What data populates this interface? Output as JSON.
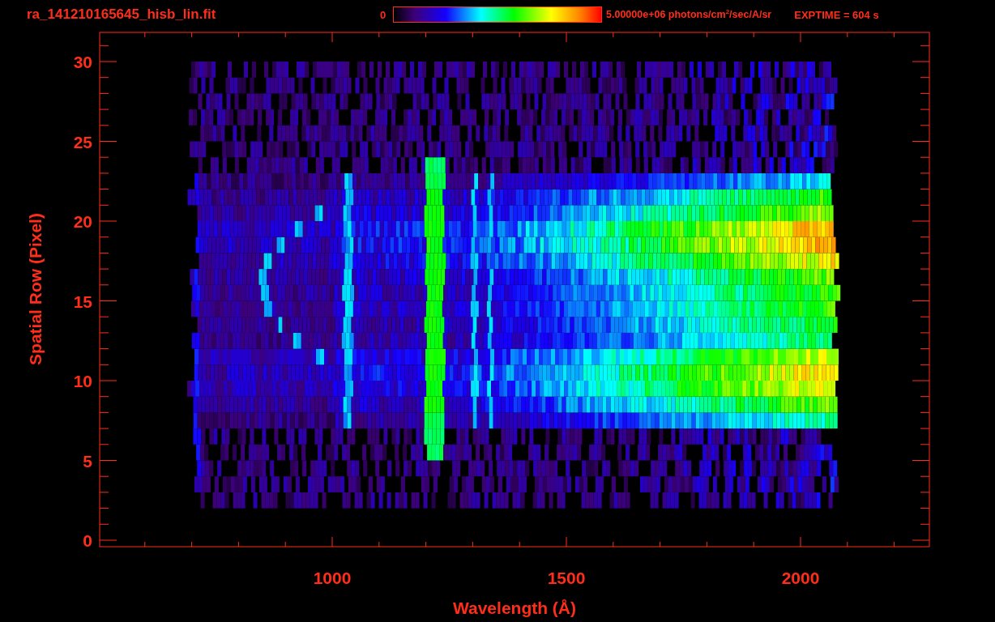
{
  "header": {
    "file_name": "ra_141210165645_hisb_lin.fit",
    "colorbar": {
      "min_label": "0",
      "max_label": "5.00000e+06 photons/cm$^{2}$/sec/A/sr"
    },
    "exposure": "EXPTIME = 604 s"
  },
  "plot": {
    "ylabel": "Spatial Row (Pixel)",
    "xlabel": "Wavelength (Å)",
    "xtick_labels": [
      "1000",
      "1500",
      "2000"
    ],
    "ytick_labels": [
      "30",
      "25",
      "20",
      "15",
      "10",
      "5",
      "0"
    ]
  }
}
